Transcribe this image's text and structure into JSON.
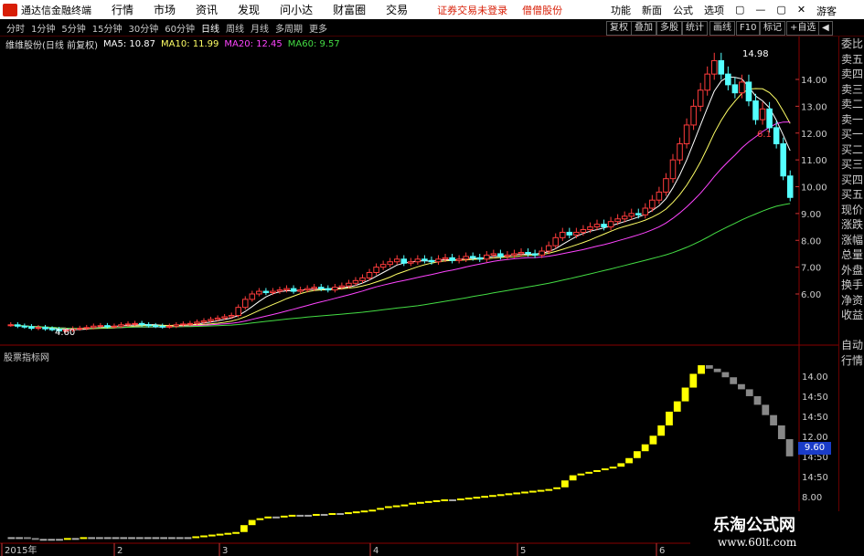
{
  "window": {
    "app_name": "通达信金融终端",
    "menus": [
      "行情",
      "市场",
      "资讯",
      "发现",
      "问小达",
      "财富圈",
      "交易"
    ],
    "notice": "证券交易未登录",
    "user": "僧僧股份",
    "right_menus": [
      "功能",
      "新面",
      "公式",
      "选项"
    ],
    "guest": "游客",
    "controls": [
      "▢",
      "—",
      "▢",
      "✕"
    ]
  },
  "toolbar": {
    "tabs": [
      "分时",
      "1分钟",
      "5分钟",
      "15分钟",
      "30分钟",
      "60分钟",
      "日线",
      "周线",
      "月线",
      "多周期",
      "更多"
    ],
    "active": "日线",
    "right_buttons": [
      "复权",
      "叠加",
      "多股",
      "统计",
      "画线",
      "F10",
      "标记",
      "+自选",
      "◀"
    ]
  },
  "info": {
    "name": "维维股份(日线 前复权)",
    "ma5": "MA5: 10.87",
    "ma10": "MA10: 11.99",
    "ma20": "MA20: 12.45",
    "ma60": "MA60: 9.57",
    "colors": {
      "ma5": "#ffffff",
      "ma10": "#ffff66",
      "ma20": "#ff44ff",
      "ma60": "#44dd44"
    }
  },
  "sidebar": [
    "委比",
    "卖五",
    "卖四",
    "卖三",
    "卖二",
    "卖一",
    "买一",
    "买二",
    "买三",
    "买四",
    "买五",
    "现价",
    "涨跌",
    "涨幅",
    "总量",
    "外盘",
    "换手",
    "净资",
    "收益",
    "",
    "自动",
    "行情"
  ],
  "indicator": {
    "label": "股票指标网",
    "value_box": "9.60"
  },
  "chart_data": {
    "type": "candlestick",
    "price_axis_ticks": [
      "14.00",
      "13.00",
      "12.00",
      "11.00",
      "10.00",
      "9.00",
      "8.00",
      "7.00",
      "6.00"
    ],
    "indicator_axis_ticks": [
      "14.00",
      "14:50",
      "14:50",
      "12.00",
      "14:50",
      "14:50",
      "8.00",
      "14:50"
    ],
    "date_labels": [
      "2015年",
      "2",
      "3",
      "4",
      "5",
      "6"
    ],
    "annotations": {
      "high": "14.98",
      "low": "4.60",
      "other": "6.1"
    },
    "closes": [
      4.85,
      4.8,
      4.78,
      4.72,
      4.75,
      4.7,
      4.68,
      4.62,
      4.65,
      4.7,
      4.72,
      4.75,
      4.8,
      4.82,
      4.78,
      4.8,
      4.85,
      4.88,
      4.9,
      4.85,
      4.82,
      4.8,
      4.78,
      4.8,
      4.85,
      4.88,
      4.9,
      4.95,
      5.0,
      5.05,
      5.1,
      5.15,
      5.2,
      5.5,
      5.8,
      6.0,
      6.1,
      6.05,
      6.1,
      6.15,
      6.2,
      6.1,
      6.15,
      6.2,
      6.25,
      6.2,
      6.15,
      6.25,
      6.3,
      6.4,
      6.5,
      6.6,
      6.8,
      7.0,
      7.1,
      7.2,
      7.3,
      7.15,
      7.2,
      7.3,
      7.25,
      7.2,
      7.3,
      7.35,
      7.25,
      7.3,
      7.4,
      7.35,
      7.3,
      7.45,
      7.5,
      7.4,
      7.45,
      7.5,
      7.55,
      7.5,
      7.45,
      7.6,
      7.8,
      8.1,
      8.3,
      8.2,
      8.3,
      8.4,
      8.5,
      8.6,
      8.5,
      8.7,
      8.8,
      8.9,
      9.0,
      8.95,
      9.2,
      9.5,
      9.8,
      10.3,
      11.0,
      11.6,
      12.3,
      13.0,
      13.6,
      14.2,
      14.7,
      14.2,
      13.8,
      13.5,
      13.9,
      13.2,
      12.5,
      12.9,
      12.2,
      11.6,
      10.4,
      9.6
    ],
    "indicator_values": [
      4.9,
      4.9,
      4.85,
      4.8,
      4.8,
      4.8,
      4.8,
      4.85,
      4.85,
      4.9,
      4.9,
      4.9,
      4.9,
      4.9,
      4.9,
      4.9,
      4.9,
      4.9,
      4.9,
      4.9,
      4.9,
      4.9,
      4.9,
      4.95,
      5.0,
      5.05,
      5.1,
      5.15,
      5.2,
      5.6,
      5.9,
      6.0,
      6.1,
      6.1,
      6.15,
      6.2,
      6.2,
      6.2,
      6.25,
      6.25,
      6.3,
      6.3,
      6.35,
      6.4,
      6.45,
      6.5,
      6.6,
      6.7,
      6.75,
      6.8,
      6.9,
      6.95,
      7.0,
      7.05,
      7.1,
      7.1,
      7.15,
      7.2,
      7.25,
      7.3,
      7.35,
      7.4,
      7.45,
      7.5,
      7.55,
      7.6,
      7.65,
      7.7,
      7.8,
      8.2,
      8.5,
      8.6,
      8.7,
      8.8,
      8.9,
      9.0,
      9.2,
      9.5,
      9.9,
      10.3,
      10.8,
      11.4,
      12.2,
      12.8,
      13.6,
      14.4,
      14.9,
      14.7,
      14.5,
      14.2,
      13.8,
      13.5,
      13.1,
      12.6,
      12.0,
      11.4,
      10.6,
      9.6
    ]
  }
}
